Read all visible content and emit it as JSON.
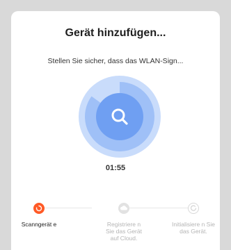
{
  "dialog": {
    "title": "Gerät hinzufügen...",
    "subtitle": "Stellen Sie sicher, dass das WLAN-Sign...",
    "timer": "01:55",
    "scan_progress": 0.85
  },
  "icons": {
    "scan": "search-icon",
    "step_scan": "scanning-spinner-icon",
    "step_cloud": "cloud-icon",
    "step_init": "init-circle-icon"
  },
  "colors": {
    "accent": "#ff5a26",
    "radar_outer": "#c9dcfb",
    "radar_sweep": "#9fc0f7",
    "radar_inner": "#6f9ff2",
    "step_inactive": "#d8d8d8",
    "label_active": "#222222",
    "label_inactive": "#b5b5b5"
  },
  "steps": [
    {
      "label": "Scanngerät e",
      "state": "active"
    },
    {
      "label": "Registriere n Sie das Gerät auf Cloud.",
      "state": "pending"
    },
    {
      "label": "Initialisiere n Sie das Gerät.",
      "state": "pending"
    }
  ]
}
